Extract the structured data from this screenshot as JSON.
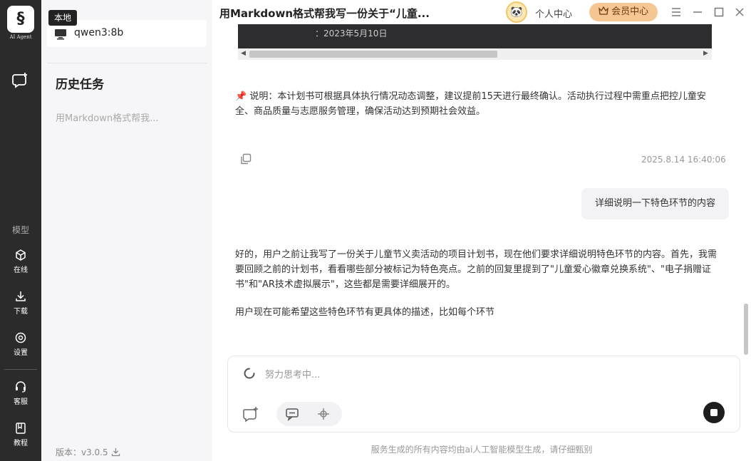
{
  "brand": {
    "logo_text": "AI Agent"
  },
  "rail": {
    "section_label": "模型",
    "items": [
      {
        "label": "在线",
        "icon": "cube-icon"
      },
      {
        "label": "下载",
        "icon": "download-icon"
      },
      {
        "label": "设置",
        "icon": "settings-icon"
      },
      {
        "label": "客服",
        "icon": "headset-icon"
      },
      {
        "label": "教程",
        "icon": "book-icon"
      }
    ]
  },
  "sidebar": {
    "tooltip": "本地",
    "model_name": "qwen3:8b",
    "history_title": "历史任务",
    "history_items": [
      "用Markdown格式帮我..."
    ],
    "version": "版本：v3.0.5"
  },
  "titlebar": {
    "title": "用Markdown格式帮我写一份关于“儿童...",
    "user_center": "个人中心",
    "vip_label": "会员中心"
  },
  "chat": {
    "code_line": "：2023年5月10日",
    "note": "说明：本计划书可根据具体执行情况动态调整，建议提前15天进行最终确认。活动执行过程中需重点把控儿童安全、商品质量与志愿服务管理，确保活动达到预期社会效益。",
    "timestamp": "2025.8.14 16:40:06",
    "user_message": "详细说明一下特色环节的内容",
    "answer_p1": "好的，用户之前让我写了一份关于儿童节义卖活动的项目计划书，现在他们要求详细说明特色环节的内容。首先，我需要回顾之前的计划书，看看哪些部分被标记为特色亮点。之前的回复里提到了\"儿童爱心徽章兑换系统\"、\"电子捐赠证书\"和\"AR技术虚拟展示\"，这些都是需要详细展开的。",
    "answer_p2": "用户现在可能希望这些特色环节有更具体的描述，比如每个环节"
  },
  "input": {
    "status_text": "努力思考中..."
  },
  "footer": "服务生成的所有内容均由ai人工智能模型生成，请仔细甄别"
}
